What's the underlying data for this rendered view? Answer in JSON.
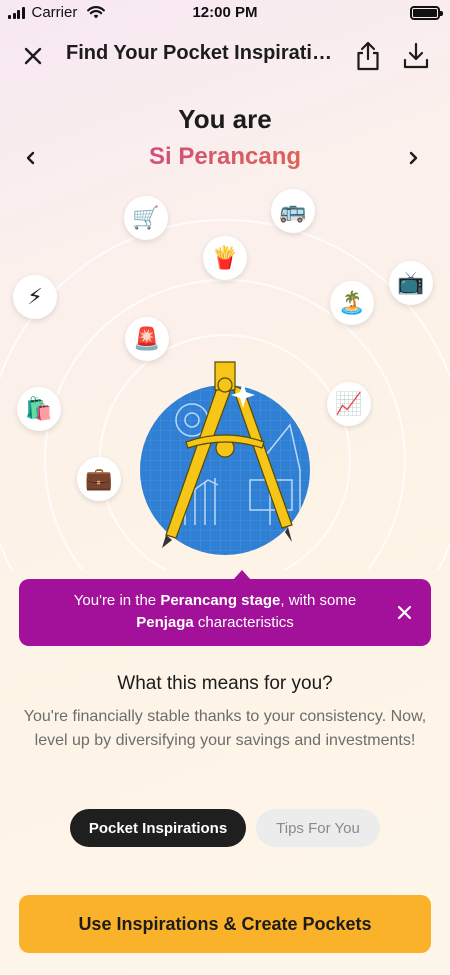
{
  "status_bar": {
    "carrier": "Carrier",
    "time": "12:00 PM"
  },
  "header": {
    "title": "Find Your Pocket Inspiration",
    "close_icon": "close-icon",
    "share_icon": "share-icon",
    "download_icon": "download-icon"
  },
  "hero": {
    "you_are": "You are",
    "persona": "Si Perancang",
    "prev_icon": "chevron-left-icon",
    "next_icon": "chevron-right-icon"
  },
  "orbit_icons": [
    {
      "name": "shopping-cart-icon",
      "glyph": "🛒"
    },
    {
      "name": "bus-icon",
      "glyph": "🚌"
    },
    {
      "name": "fries-icon",
      "glyph": "🍟"
    },
    {
      "name": "tv-icon",
      "glyph": "📺"
    },
    {
      "name": "lightning-icon",
      "glyph": "⚡"
    },
    {
      "name": "island-icon",
      "glyph": "🏝️"
    },
    {
      "name": "siren-icon",
      "glyph": "🚨"
    },
    {
      "name": "shopping-bags-icon",
      "glyph": "🛍️"
    },
    {
      "name": "chart-up-icon",
      "glyph": "📈"
    },
    {
      "name": "briefcase-icon",
      "glyph": "💼"
    }
  ],
  "banner": {
    "prefix": "You're in the ",
    "stage": "Perancang stage",
    "middle": ", with some ",
    "trait": "Penjaga",
    "suffix": " characteristics"
  },
  "means": {
    "title": "What this means for you?",
    "body": "You're financially stable thanks to your consistency. Now, level up by diversifying your savings and investments!"
  },
  "tabs": {
    "active": "Pocket Inspirations",
    "inactive": "Tips For You"
  },
  "cta": {
    "label": "Use Inspirations & Create Pockets"
  },
  "colors": {
    "banner": "#a3119b",
    "cta": "#fbb22b",
    "persona_start": "#c44096",
    "persona_end": "#e8743c",
    "illustration_blue": "#2f7fd4",
    "compass_yellow": "#f5c518"
  }
}
